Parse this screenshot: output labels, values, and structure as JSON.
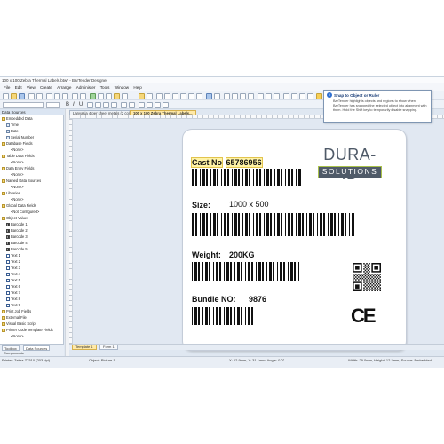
{
  "window": {
    "title": "100 x 100 Zebra Thermal Labels.btw* - BarTender Designer"
  },
  "menu": [
    "File",
    "Edit",
    "View",
    "Create",
    "Arrange",
    "Administer",
    "Tools",
    "Window",
    "Help"
  ],
  "tooltip": {
    "title": "Snap to Object or Ruler",
    "body": "BarTender highlights objects and regions to show when BarTender has snapped the selected object into alignment with them. Hold the Shift key to temporarily disable snapping."
  },
  "left_panel": {
    "header": "Data Sources",
    "tree": [
      {
        "label": "Embedded Data",
        "indent": 0,
        "icon": "folder"
      },
      {
        "label": "Time",
        "indent": 1,
        "icon": "item"
      },
      {
        "label": "Date",
        "indent": 1,
        "icon": "item"
      },
      {
        "label": "Serial Number",
        "indent": 1,
        "icon": "item"
      },
      {
        "label": "Database Fields",
        "indent": 0,
        "icon": "folder"
      },
      {
        "label": "<None>",
        "indent": 2,
        "icon": "none"
      },
      {
        "label": "Table Data Fields",
        "indent": 0,
        "icon": "folder"
      },
      {
        "label": "<None>",
        "indent": 2,
        "icon": "none"
      },
      {
        "label": "Data Entry Fields",
        "indent": 0,
        "icon": "folder"
      },
      {
        "label": "<None>",
        "indent": 2,
        "icon": "none"
      },
      {
        "label": "Named Data Sources",
        "indent": 0,
        "icon": "folder"
      },
      {
        "label": "<None>",
        "indent": 2,
        "icon": "none"
      },
      {
        "label": "Libraries",
        "indent": 0,
        "icon": "folder"
      },
      {
        "label": "<None>",
        "indent": 2,
        "icon": "none"
      },
      {
        "label": "Global Data Fields",
        "indent": 0,
        "icon": "folder"
      },
      {
        "label": "<Not Configured>",
        "indent": 2,
        "icon": "none"
      },
      {
        "label": "Object Values",
        "indent": 0,
        "icon": "folder"
      },
      {
        "label": "Barcode 1",
        "indent": 1,
        "icon": "barcode"
      },
      {
        "label": "Barcode 2",
        "indent": 1,
        "icon": "barcode"
      },
      {
        "label": "Barcode 3",
        "indent": 1,
        "icon": "barcode"
      },
      {
        "label": "Barcode 4",
        "indent": 1,
        "icon": "barcode"
      },
      {
        "label": "Barcode 5",
        "indent": 1,
        "icon": "barcode"
      },
      {
        "label": "Text 1",
        "indent": 1,
        "icon": "text"
      },
      {
        "label": "Text 2",
        "indent": 1,
        "icon": "text"
      },
      {
        "label": "Text 3",
        "indent": 1,
        "icon": "text"
      },
      {
        "label": "Text 4",
        "indent": 1,
        "icon": "text"
      },
      {
        "label": "Text 5",
        "indent": 1,
        "icon": "text"
      },
      {
        "label": "Text 6",
        "indent": 1,
        "icon": "text"
      },
      {
        "label": "Text 7",
        "indent": 1,
        "icon": "text"
      },
      {
        "label": "Text 8",
        "indent": 1,
        "icon": "text"
      },
      {
        "label": "Text 9",
        "indent": 1,
        "icon": "text"
      },
      {
        "label": "Print Job Fields",
        "indent": 0,
        "icon": "folder"
      },
      {
        "label": "External File",
        "indent": 0,
        "icon": "folder"
      },
      {
        "label": "Visual Basic Script",
        "indent": 0,
        "icon": "folder"
      },
      {
        "label": "Printer Code Template Fields",
        "indent": 0,
        "icon": "folder"
      },
      {
        "label": "<None>",
        "indent": 2,
        "icon": "none"
      }
    ],
    "tabs": [
      "Toolbox",
      "Data Sources"
    ],
    "sub_tab": "Components"
  },
  "doc_tabs": [
    "Lanyasia 4 per sheet metals (2 colo)s...",
    "100 x 100 Zebra Thermal Labels..."
  ],
  "bottom_tabs": [
    "Template 1",
    "Form 1"
  ],
  "label": {
    "cast_no_label": "Cast No",
    "cast_no_value": "65786956",
    "size_label": "Size:",
    "size_value": "1000 x 500",
    "weight_label": "Weight:",
    "weight_value": "200KG",
    "bundle_label": "Bundle NO:",
    "bundle_value": "9876",
    "logo_top": "DURA-ID",
    "logo_bottom": "SOLUTIONS",
    "ce_mark": "CE"
  },
  "status": {
    "printer": "Printer: Zebra ZT510 (203 dpi)",
    "object": "Object: Picture 1",
    "position": "X: 62.9mm, Y: 31.1mm, Angle: 0.0°",
    "size": "Width: 29.0mm, Height: 12.2mm, Source: Embedded"
  },
  "colors": {
    "selection": "#fff3a6",
    "logo_border": "#a9c14a",
    "logo_fill": "#4f5a68",
    "active_tab": "#ffe9a8"
  }
}
